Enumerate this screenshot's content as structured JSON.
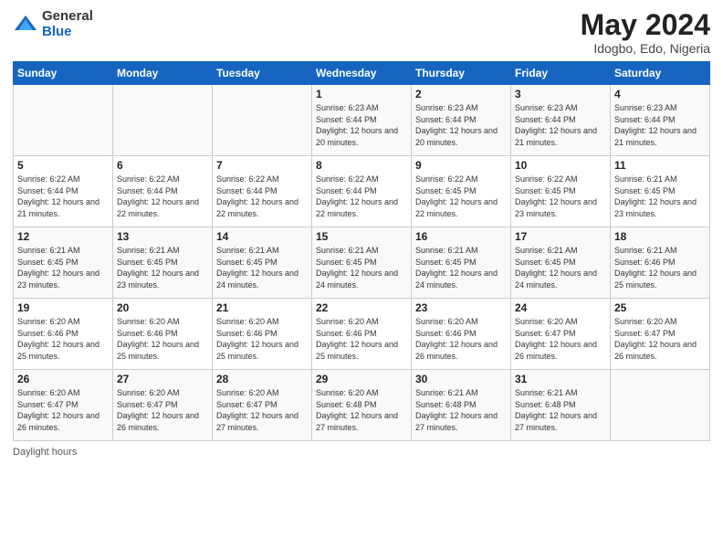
{
  "logo": {
    "general": "General",
    "blue": "Blue"
  },
  "title": "May 2024",
  "location": "Idogbo, Edo, Nigeria",
  "days_header": [
    "Sunday",
    "Monday",
    "Tuesday",
    "Wednesday",
    "Thursday",
    "Friday",
    "Saturday"
  ],
  "rows": [
    [
      {
        "day": "",
        "info": ""
      },
      {
        "day": "",
        "info": ""
      },
      {
        "day": "",
        "info": ""
      },
      {
        "day": "1",
        "info": "Sunrise: 6:23 AM\nSunset: 6:44 PM\nDaylight: 12 hours and 20 minutes."
      },
      {
        "day": "2",
        "info": "Sunrise: 6:23 AM\nSunset: 6:44 PM\nDaylight: 12 hours and 20 minutes."
      },
      {
        "day": "3",
        "info": "Sunrise: 6:23 AM\nSunset: 6:44 PM\nDaylight: 12 hours and 21 minutes."
      },
      {
        "day": "4",
        "info": "Sunrise: 6:23 AM\nSunset: 6:44 PM\nDaylight: 12 hours and 21 minutes."
      }
    ],
    [
      {
        "day": "5",
        "info": "Sunrise: 6:22 AM\nSunset: 6:44 PM\nDaylight: 12 hours and 21 minutes."
      },
      {
        "day": "6",
        "info": "Sunrise: 6:22 AM\nSunset: 6:44 PM\nDaylight: 12 hours and 22 minutes."
      },
      {
        "day": "7",
        "info": "Sunrise: 6:22 AM\nSunset: 6:44 PM\nDaylight: 12 hours and 22 minutes."
      },
      {
        "day": "8",
        "info": "Sunrise: 6:22 AM\nSunset: 6:44 PM\nDaylight: 12 hours and 22 minutes."
      },
      {
        "day": "9",
        "info": "Sunrise: 6:22 AM\nSunset: 6:45 PM\nDaylight: 12 hours and 22 minutes."
      },
      {
        "day": "10",
        "info": "Sunrise: 6:22 AM\nSunset: 6:45 PM\nDaylight: 12 hours and 23 minutes."
      },
      {
        "day": "11",
        "info": "Sunrise: 6:21 AM\nSunset: 6:45 PM\nDaylight: 12 hours and 23 minutes."
      }
    ],
    [
      {
        "day": "12",
        "info": "Sunrise: 6:21 AM\nSunset: 6:45 PM\nDaylight: 12 hours and 23 minutes."
      },
      {
        "day": "13",
        "info": "Sunrise: 6:21 AM\nSunset: 6:45 PM\nDaylight: 12 hours and 23 minutes."
      },
      {
        "day": "14",
        "info": "Sunrise: 6:21 AM\nSunset: 6:45 PM\nDaylight: 12 hours and 24 minutes."
      },
      {
        "day": "15",
        "info": "Sunrise: 6:21 AM\nSunset: 6:45 PM\nDaylight: 12 hours and 24 minutes."
      },
      {
        "day": "16",
        "info": "Sunrise: 6:21 AM\nSunset: 6:45 PM\nDaylight: 12 hours and 24 minutes."
      },
      {
        "day": "17",
        "info": "Sunrise: 6:21 AM\nSunset: 6:45 PM\nDaylight: 12 hours and 24 minutes."
      },
      {
        "day": "18",
        "info": "Sunrise: 6:21 AM\nSunset: 6:46 PM\nDaylight: 12 hours and 25 minutes."
      }
    ],
    [
      {
        "day": "19",
        "info": "Sunrise: 6:20 AM\nSunset: 6:46 PM\nDaylight: 12 hours and 25 minutes."
      },
      {
        "day": "20",
        "info": "Sunrise: 6:20 AM\nSunset: 6:46 PM\nDaylight: 12 hours and 25 minutes."
      },
      {
        "day": "21",
        "info": "Sunrise: 6:20 AM\nSunset: 6:46 PM\nDaylight: 12 hours and 25 minutes."
      },
      {
        "day": "22",
        "info": "Sunrise: 6:20 AM\nSunset: 6:46 PM\nDaylight: 12 hours and 25 minutes."
      },
      {
        "day": "23",
        "info": "Sunrise: 6:20 AM\nSunset: 6:46 PM\nDaylight: 12 hours and 26 minutes."
      },
      {
        "day": "24",
        "info": "Sunrise: 6:20 AM\nSunset: 6:47 PM\nDaylight: 12 hours and 26 minutes."
      },
      {
        "day": "25",
        "info": "Sunrise: 6:20 AM\nSunset: 6:47 PM\nDaylight: 12 hours and 26 minutes."
      }
    ],
    [
      {
        "day": "26",
        "info": "Sunrise: 6:20 AM\nSunset: 6:47 PM\nDaylight: 12 hours and 26 minutes."
      },
      {
        "day": "27",
        "info": "Sunrise: 6:20 AM\nSunset: 6:47 PM\nDaylight: 12 hours and 26 minutes."
      },
      {
        "day": "28",
        "info": "Sunrise: 6:20 AM\nSunset: 6:47 PM\nDaylight: 12 hours and 27 minutes."
      },
      {
        "day": "29",
        "info": "Sunrise: 6:20 AM\nSunset: 6:48 PM\nDaylight: 12 hours and 27 minutes."
      },
      {
        "day": "30",
        "info": "Sunrise: 6:21 AM\nSunset: 6:48 PM\nDaylight: 12 hours and 27 minutes."
      },
      {
        "day": "31",
        "info": "Sunrise: 6:21 AM\nSunset: 6:48 PM\nDaylight: 12 hours and 27 minutes."
      },
      {
        "day": "",
        "info": ""
      }
    ]
  ],
  "footer": "Daylight hours"
}
